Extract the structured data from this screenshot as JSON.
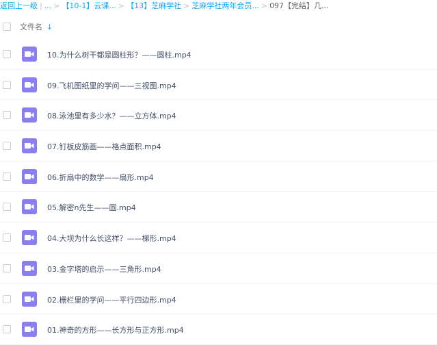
{
  "breadcrumb": {
    "back_label": "返回上一级",
    "divider": "|",
    "ellipsis": "...",
    "separator": ">",
    "items": [
      "【10-1】云课...",
      "【13】芝麻学社",
      "芝麻学社两年会员...",
      "097【完结】几..."
    ]
  },
  "header": {
    "column_name": "文件名",
    "sort_icon": "arrow-down-icon",
    "sort_glyph": "↓"
  },
  "files": [
    {
      "name": "10.为什么树干都是圆柱形？——圆柱.mp4",
      "icon": "video-file-icon"
    },
    {
      "name": "09.飞机图纸里的学问——三视图.mp4",
      "icon": "video-file-icon"
    },
    {
      "name": "08.泳池里有多少水？——立方体.mp4",
      "icon": "video-file-icon"
    },
    {
      "name": "07.钉板皮筋画——格点面积.mp4",
      "icon": "video-file-icon"
    },
    {
      "name": "06.折扇中的数学——扇形.mp4",
      "icon": "video-file-icon"
    },
    {
      "name": "05.解密n先生——圆.mp4",
      "icon": "video-file-icon"
    },
    {
      "name": "04.大坝为什么长这样？——梯形.mp4",
      "icon": "video-file-icon"
    },
    {
      "name": "03.金字塔的启示——三角形.mp4",
      "icon": "video-file-icon"
    },
    {
      "name": "02.栅栏里的学问——平行四边形.mp4",
      "icon": "video-file-icon"
    },
    {
      "name": "01.神奇的方形——长方形与正方形.mp4",
      "icon": "video-file-icon"
    }
  ],
  "colors": {
    "link": "#09aaff",
    "video_icon": "#8b7ff0",
    "text": "#424e67"
  }
}
